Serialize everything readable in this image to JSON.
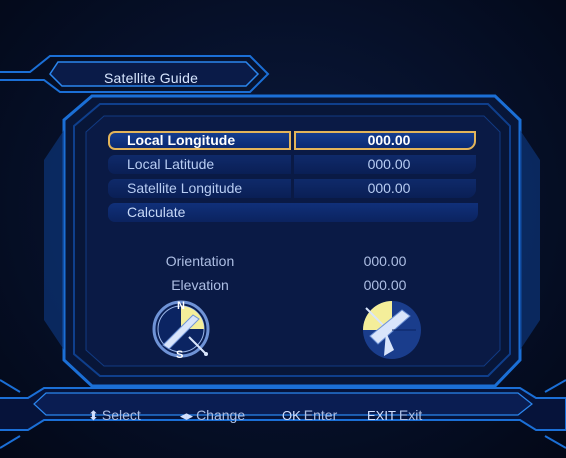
{
  "window": {
    "title": "Satellite Guide"
  },
  "menu": {
    "items": [
      {
        "label": "Local Longitude",
        "value": "000.00"
      },
      {
        "label": "Local Latitude",
        "value": "000.00"
      },
      {
        "label": "Satellite Longitude",
        "value": "000.00"
      }
    ],
    "calculate_label": "Calculate"
  },
  "results": {
    "orientation_label": "Orientation",
    "orientation_value": "000.00",
    "elevation_label": "Elevation",
    "elevation_value": "000.00"
  },
  "compass": {
    "north": "N",
    "south": "S"
  },
  "footer": {
    "select": {
      "key": "⬍",
      "label": "Select"
    },
    "change": {
      "key": "◂▸",
      "label": "Change"
    },
    "enter": {
      "key": "OK",
      "label": "Enter"
    },
    "exit": {
      "key": "EXIT",
      "label": "Exit"
    }
  },
  "colors": {
    "frame": "#1b6fd6",
    "highlight_border": "#e2b45a",
    "row_fill": "#0b2260",
    "accent_yellow": "#f4ee9a"
  }
}
